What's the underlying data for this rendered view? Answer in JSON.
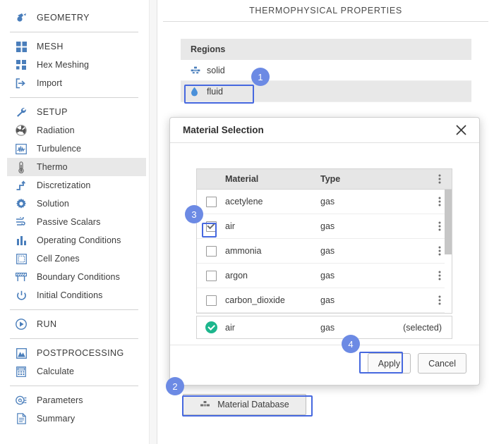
{
  "sidebar": {
    "groups": [
      {
        "items": [
          {
            "label": "GEOMETRY",
            "icon": "geometry-icon",
            "caps": true,
            "selected": false
          }
        ]
      },
      {
        "items": [
          {
            "label": "MESH",
            "icon": "mesh-grid-icon",
            "caps": true,
            "selected": false
          },
          {
            "label": "Hex Meshing",
            "icon": "hex-meshing-icon",
            "caps": false,
            "selected": false
          },
          {
            "label": "Import",
            "icon": "import-icon",
            "caps": false,
            "selected": false
          }
        ]
      },
      {
        "items": [
          {
            "label": "SETUP",
            "icon": "wrench-icon",
            "caps": true,
            "selected": false
          },
          {
            "label": "Radiation",
            "icon": "radiation-icon",
            "caps": false,
            "selected": false
          },
          {
            "label": "Turbulence",
            "icon": "turbulence-icon",
            "caps": false,
            "selected": false
          },
          {
            "label": "Thermo",
            "icon": "thermometer-icon",
            "caps": false,
            "selected": true
          },
          {
            "label": "Discretization",
            "icon": "discretization-icon",
            "caps": false,
            "selected": false
          },
          {
            "label": "Solution",
            "icon": "gear-icon",
            "caps": false,
            "selected": false
          },
          {
            "label": "Passive Scalars",
            "icon": "passive-scalars-icon",
            "caps": false,
            "selected": false
          },
          {
            "label": "Operating Conditions",
            "icon": "bar-chart-icon",
            "caps": false,
            "selected": false
          },
          {
            "label": "Cell Zones",
            "icon": "cell-zones-icon",
            "caps": false,
            "selected": false
          },
          {
            "label": "Boundary Conditions",
            "icon": "boundary-conditions-icon",
            "caps": false,
            "selected": false
          },
          {
            "label": "Initial Conditions",
            "icon": "power-icon",
            "caps": false,
            "selected": false
          }
        ]
      },
      {
        "items": [
          {
            "label": "RUN",
            "icon": "play-icon",
            "caps": true,
            "selected": false
          }
        ]
      },
      {
        "items": [
          {
            "label": "POSTPROCESSING",
            "icon": "postprocessing-icon",
            "caps": true,
            "selected": false
          },
          {
            "label": "Calculate",
            "icon": "calculator-icon",
            "caps": false,
            "selected": false
          }
        ]
      },
      {
        "items": [
          {
            "label": "Parameters",
            "icon": "parameters-icon",
            "caps": false,
            "selected": false
          },
          {
            "label": "Summary",
            "icon": "document-icon",
            "caps": false,
            "selected": false
          }
        ]
      }
    ]
  },
  "main": {
    "title": "THERMOPHYSICAL PROPERTIES",
    "regions": {
      "header": "Regions",
      "rows": [
        {
          "label": "solid",
          "icon": "solid-stack-icon",
          "highlighted": false
        },
        {
          "label": "fluid",
          "icon": "droplet-icon",
          "highlighted": true
        }
      ]
    },
    "material_database_button": "Material Database"
  },
  "dialog": {
    "title": "Material Selection",
    "close_icon": "close-icon",
    "table": {
      "columns": [
        "Material",
        "Type"
      ],
      "kebab_icon": "kebab-menu-icon",
      "rows": [
        {
          "checked": false,
          "material": "acetylene",
          "type": "gas"
        },
        {
          "checked": true,
          "material": "air",
          "type": "gas"
        },
        {
          "checked": false,
          "material": "ammonia",
          "type": "gas"
        },
        {
          "checked": false,
          "material": "argon",
          "type": "gas"
        },
        {
          "checked": false,
          "material": "carbon_dioxide",
          "type": "gas"
        }
      ]
    },
    "selected_row": {
      "material": "air",
      "type": "gas",
      "note": "(selected)"
    },
    "apply_label": "Apply",
    "cancel_label": "Cancel"
  },
  "badges": [
    {
      "num": "1"
    },
    {
      "num": "2"
    },
    {
      "num": "3"
    },
    {
      "num": "4"
    }
  ],
  "colors": {
    "accent_blue": "#4668df",
    "badge_blue": "#6c8ae4",
    "icon_blue": "#4a7ebb",
    "selected_green": "#1db68d",
    "panel_gray": "#e8e8e8"
  }
}
